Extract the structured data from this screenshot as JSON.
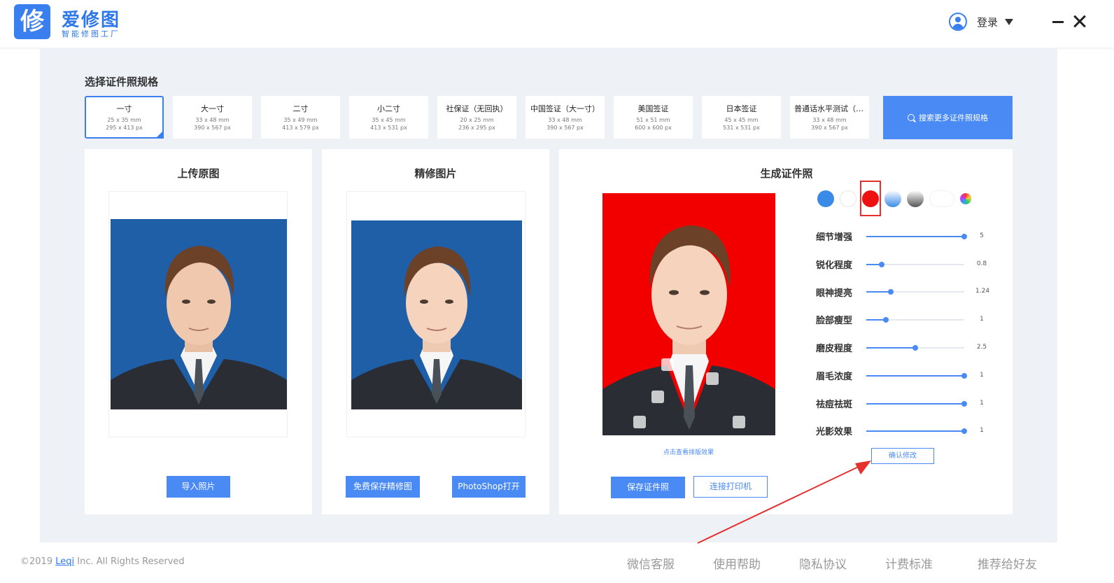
{
  "app": {
    "logo_char": "修",
    "name": "爱修图",
    "subtitle": "智能修图工厂"
  },
  "header": {
    "login_label": "登录"
  },
  "specs": {
    "title": "选择证件照规格",
    "items": [
      {
        "name": "一寸",
        "mm": "25 x 35 mm",
        "px": "295 x 413 px"
      },
      {
        "name": "大一寸",
        "mm": "33 x 48 mm",
        "px": "390 x 567 px"
      },
      {
        "name": "二寸",
        "mm": "35 x 49 mm",
        "px": "413 x 579 px"
      },
      {
        "name": "小二寸",
        "mm": "35 x 45 mm",
        "px": "413 x 531 px"
      },
      {
        "name": "社保证（无回执）",
        "mm": "20 x 25 mm",
        "px": "236 x 295 px"
      },
      {
        "name": "中国签证（大一寸）",
        "mm": "33 x 48 mm",
        "px": "390 x 567 px"
      },
      {
        "name": "美国签证",
        "mm": "51 x 51 mm",
        "px": "600 x 600 px"
      },
      {
        "name": "日本签证",
        "mm": "45 x 45 mm",
        "px": "531 x 531 px"
      },
      {
        "name": "普通话水平测试（大…",
        "mm": "33 x 48 mm",
        "px": "390 x 567 px"
      }
    ],
    "search_label": "搜索更多证件照规格"
  },
  "panels": {
    "upload": {
      "title": "上传原图",
      "button": "导入照片"
    },
    "retouch": {
      "title": "精修图片",
      "save_button": "免费保存精修图",
      "ps_button": "PhotoShop打开"
    },
    "generate": {
      "title": "生成证件照",
      "preview_link": "点击查看排版效果",
      "confirm_button": "确认修改",
      "save_button": "保存证件照",
      "print_button": "连接打印机"
    }
  },
  "colors": {
    "accent": "#4a8af4",
    "blue_bg": "#1f5fa8",
    "red_bg": "#f20000",
    "swatches": [
      "#3a8ae8",
      "#ffffff",
      "#ee1111",
      "gradient-blue",
      "gradient-gray",
      "#ffffff",
      "rainbow"
    ]
  },
  "sliders": [
    {
      "label": "细节增强",
      "value": "5",
      "level": 1.0
    },
    {
      "label": "锐化程度",
      "value": "0.8",
      "level": 0.16
    },
    {
      "label": "眼神提亮",
      "value": "1.24",
      "level": 0.25
    },
    {
      "label": "脸部瘦型",
      "value": "1",
      "level": 0.2
    },
    {
      "label": "磨皮程度",
      "value": "2.5",
      "level": 0.5
    },
    {
      "label": "眉毛浓度",
      "value": "1",
      "level": 1.0
    },
    {
      "label": "祛痘祛斑",
      "value": "1",
      "level": 1.0
    },
    {
      "label": "光影效果",
      "value": "1",
      "level": 1.0
    }
  ],
  "footer": {
    "copyright_prefix": "©2019",
    "company_link": "Leqi",
    "copyright_suffix": "Inc. All Rights Reserved",
    "links": [
      "微信客服",
      "使用帮助",
      "隐私协议",
      "计费标准",
      "推荐给好友"
    ]
  }
}
